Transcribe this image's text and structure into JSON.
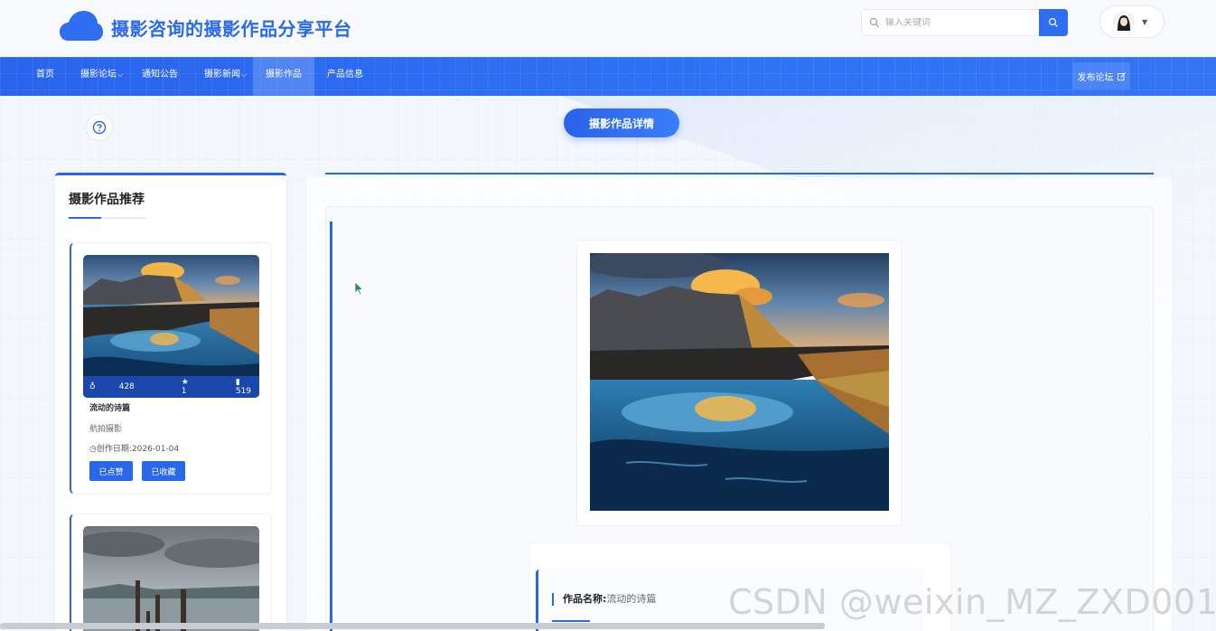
{
  "header": {
    "site_title": "摄影咨询的摄影作品分享平台",
    "search_placeholder": "输入关键词"
  },
  "nav": {
    "items": [
      {
        "label": "首页",
        "dropdown": false
      },
      {
        "label": "摄影论坛",
        "dropdown": true
      },
      {
        "label": "通知公告",
        "dropdown": false
      },
      {
        "label": "摄影新闻",
        "dropdown": true
      },
      {
        "label": "摄影作品",
        "dropdown": false,
        "active": true
      },
      {
        "label": "产品信息",
        "dropdown": false
      }
    ],
    "publish_label": "发布论坛"
  },
  "detail_title": "摄影作品详情",
  "sidebar": {
    "title": "摄影作品推荐",
    "cards": [
      {
        "likes": "428",
        "stars": "1",
        "views": "519",
        "name": "流动的诗篇",
        "category": "航拍摄影",
        "date_label": "创作日期:",
        "date": "2026-01-04",
        "liked_label": "已点赞",
        "collected_label": "已收藏"
      }
    ]
  },
  "detail": {
    "name_label": "作品名称:",
    "name_value": "流动的诗篇"
  },
  "watermark": "CSDN @weixin_MZ_ZXD001",
  "colors": {
    "primary": "#2a66e8",
    "title_blue": "#2a6ae8"
  }
}
